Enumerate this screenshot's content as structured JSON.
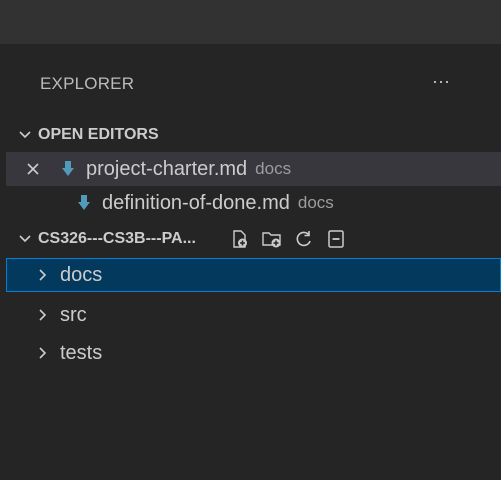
{
  "sidebar": {
    "title": "EXPLORER",
    "more_label": "···"
  },
  "open_editors": {
    "header": "OPEN EDITORS",
    "items": [
      {
        "name": "project-charter.md",
        "desc": "docs"
      },
      {
        "name": "definition-of-done.md",
        "desc": "docs"
      }
    ]
  },
  "workspace": {
    "header": "CS326---CS3B---PA...",
    "actions": [
      "new-file-icon",
      "new-folder-icon",
      "refresh-icon",
      "collapse-all-icon"
    ],
    "items": [
      {
        "name": "docs"
      },
      {
        "name": "src"
      },
      {
        "name": "tests"
      }
    ]
  },
  "colors": {
    "background": "#252526",
    "titlebar": "#323233",
    "selected": "#04395e",
    "focus_border": "#007fd4",
    "md_icon": "#519aba"
  }
}
